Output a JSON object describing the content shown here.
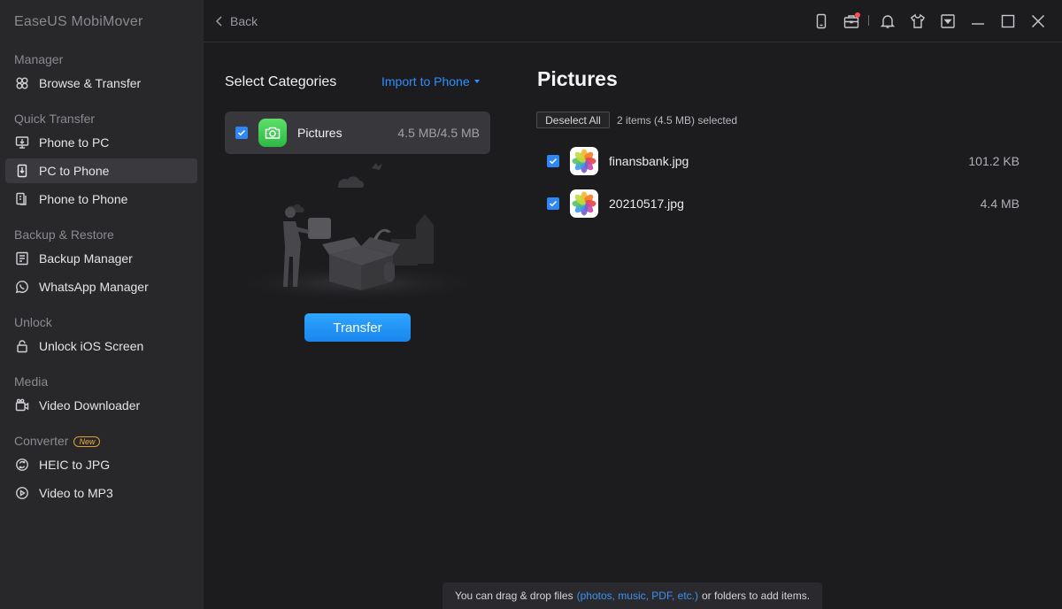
{
  "app": {
    "title": "EaseUS MobiMover"
  },
  "sidebar": {
    "sections": [
      {
        "label": "Manager",
        "items": [
          {
            "label": "Browse & Transfer",
            "icon": "browse-transfer-icon"
          }
        ]
      },
      {
        "label": "Quick Transfer",
        "items": [
          {
            "label": "Phone to PC",
            "icon": "phone-to-pc-icon"
          },
          {
            "label": "PC to Phone",
            "icon": "pc-to-phone-icon",
            "active": true
          },
          {
            "label": "Phone to Phone",
            "icon": "phone-to-phone-icon"
          }
        ]
      },
      {
        "label": "Backup & Restore",
        "items": [
          {
            "label": "Backup Manager",
            "icon": "backup-icon"
          },
          {
            "label": "WhatsApp Manager",
            "icon": "whatsapp-icon"
          }
        ]
      },
      {
        "label": "Unlock",
        "items": [
          {
            "label": "Unlock iOS Screen",
            "icon": "lock-icon"
          }
        ]
      },
      {
        "label": "Media",
        "items": [
          {
            "label": "Video Downloader",
            "icon": "video-download-icon"
          }
        ]
      },
      {
        "label": "Converter",
        "badge": "New",
        "items": [
          {
            "label": "HEIC to JPG",
            "icon": "convert-image-icon"
          },
          {
            "label": "Video to MP3",
            "icon": "convert-audio-icon"
          }
        ]
      }
    ]
  },
  "topbar": {
    "back_label": "Back",
    "icons": [
      "device-icon",
      "toolbox-icon",
      "bell-icon",
      "shirt-icon",
      "dropdown-menu-icon",
      "minimize-icon",
      "maximize-icon",
      "close-icon"
    ]
  },
  "categories": {
    "heading": "Select Categories",
    "import_label": "Import to Phone",
    "items": [
      {
        "name": "Pictures",
        "size": "4.5 MB/4.5 MB",
        "checked": true
      }
    ]
  },
  "transfer": {
    "label": "Transfer"
  },
  "files": {
    "title": "Pictures",
    "deselect_label": "Deselect All",
    "status": "2 items (4.5 MB) selected",
    "items": [
      {
        "name": "finansbank.jpg",
        "size": "101.2 KB",
        "checked": true
      },
      {
        "name": "20210517.jpg",
        "size": "4.4 MB",
        "checked": true
      }
    ]
  },
  "hint": {
    "prefix": "You can drag & drop files",
    "highlight": "(photos, music, PDF, etc.)",
    "suffix": "or folders to add items."
  },
  "colors": {
    "accent": "#2f86f6",
    "badge": "#f0b040",
    "notification": "#ff4d4f"
  }
}
